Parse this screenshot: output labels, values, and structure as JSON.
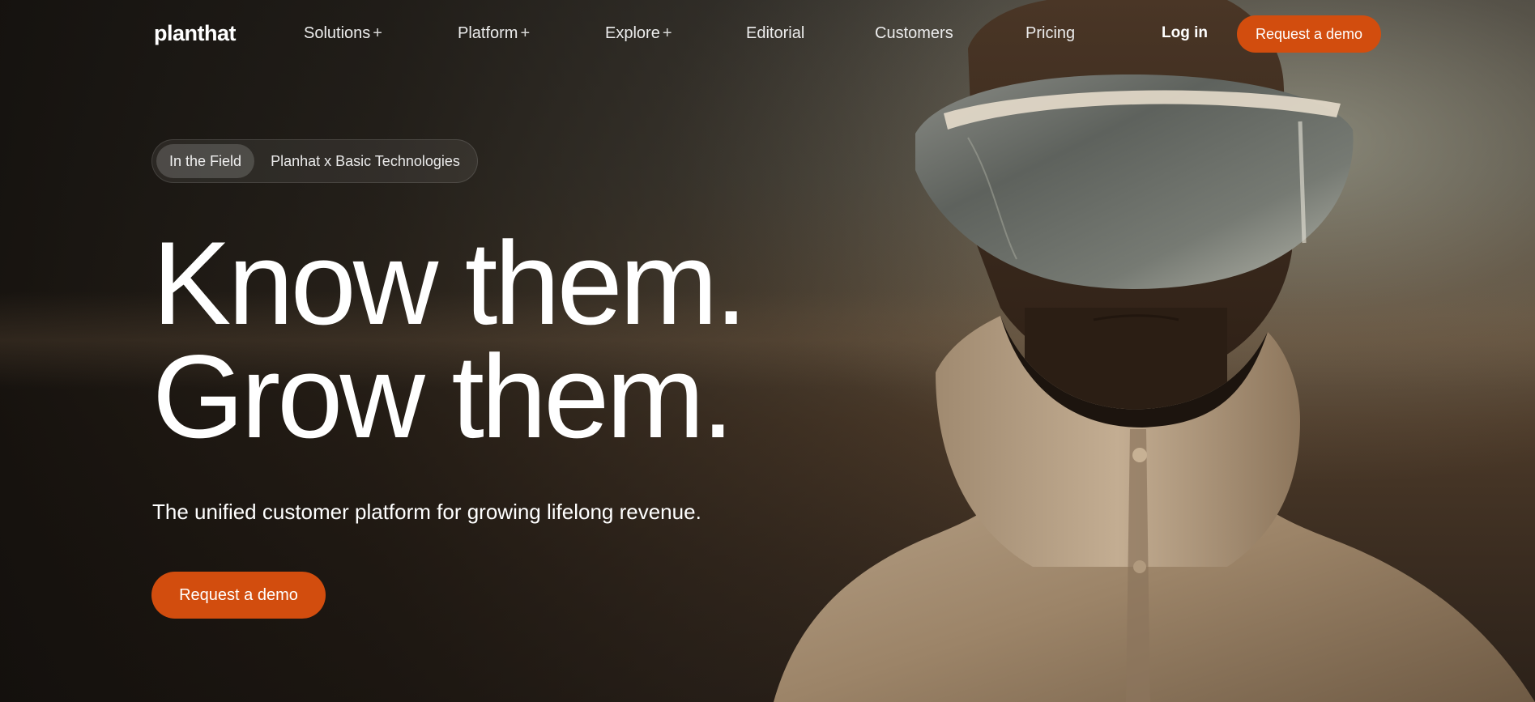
{
  "nav": {
    "logo": "planthat",
    "items": [
      {
        "label": "Solutions",
        "suffix": "+"
      },
      {
        "label": "Platform",
        "suffix": "+"
      },
      {
        "label": "Explore",
        "suffix": "+"
      },
      {
        "label": "Editorial",
        "suffix": ""
      },
      {
        "label": "Customers",
        "suffix": ""
      },
      {
        "label": "Pricing",
        "suffix": ""
      }
    ],
    "login": "Log in",
    "cta": "Request a demo"
  },
  "hero": {
    "tag": "In the Field",
    "tag_text": "Planhat x Basic Technologies",
    "headline_line1": "Know them.",
    "headline_line2": "Grow them.",
    "subtitle": "The unified customer platform for growing lifelong revenue.",
    "cta": "Request a demo"
  },
  "colors": {
    "accent": "#d24d0e"
  }
}
